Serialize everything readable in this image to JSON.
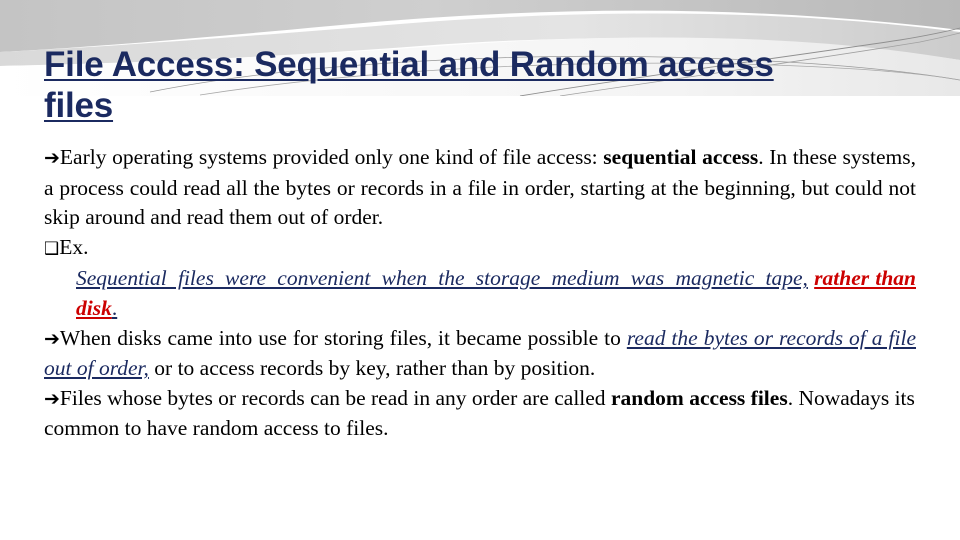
{
  "slide": {
    "title": {
      "line1_part1": "File Access: Sequential and Random access",
      "line2": "files",
      "color": "#1b2a60"
    },
    "bullets": {
      "arrow_glyph": "➔",
      "square_glyph": "❑"
    },
    "paragraph1": {
      "text_before_bold": "Early operating systems provided only one kind of file access: ",
      "bold1": "sequential",
      "bold2": "access",
      "text_after_bold": ". In these systems, a process could read all the bytes or records in a file in order, starting at the beginning, but could not skip around and read them out of order."
    },
    "paragraph2": {
      "label": "Ex.",
      "italic_navy_part1": "Sequential files were convenient when the storage medium was magnetic tape,",
      "italic_red_part": "rather than disk",
      "trailing": "."
    },
    "paragraph3": {
      "text_before": "When disks came into use for storing files, it became possible to ",
      "italic_underline": "read the bytes or records of a file out of order,",
      "text_after": " or to access records by key, rather than by position."
    },
    "paragraph4": {
      "text_before": "Files whose bytes or records can be read in any order are called ",
      "bold1": "random",
      "bold2": "access files",
      "text_after": ". Nowadays its common to have random access to files."
    },
    "colors": {
      "title_navy": "#1b2a60",
      "accent_red": "#cc0000",
      "body_black": "#000000",
      "swoosh_gray": "#c8c8c8",
      "background": "#ffffff"
    }
  }
}
